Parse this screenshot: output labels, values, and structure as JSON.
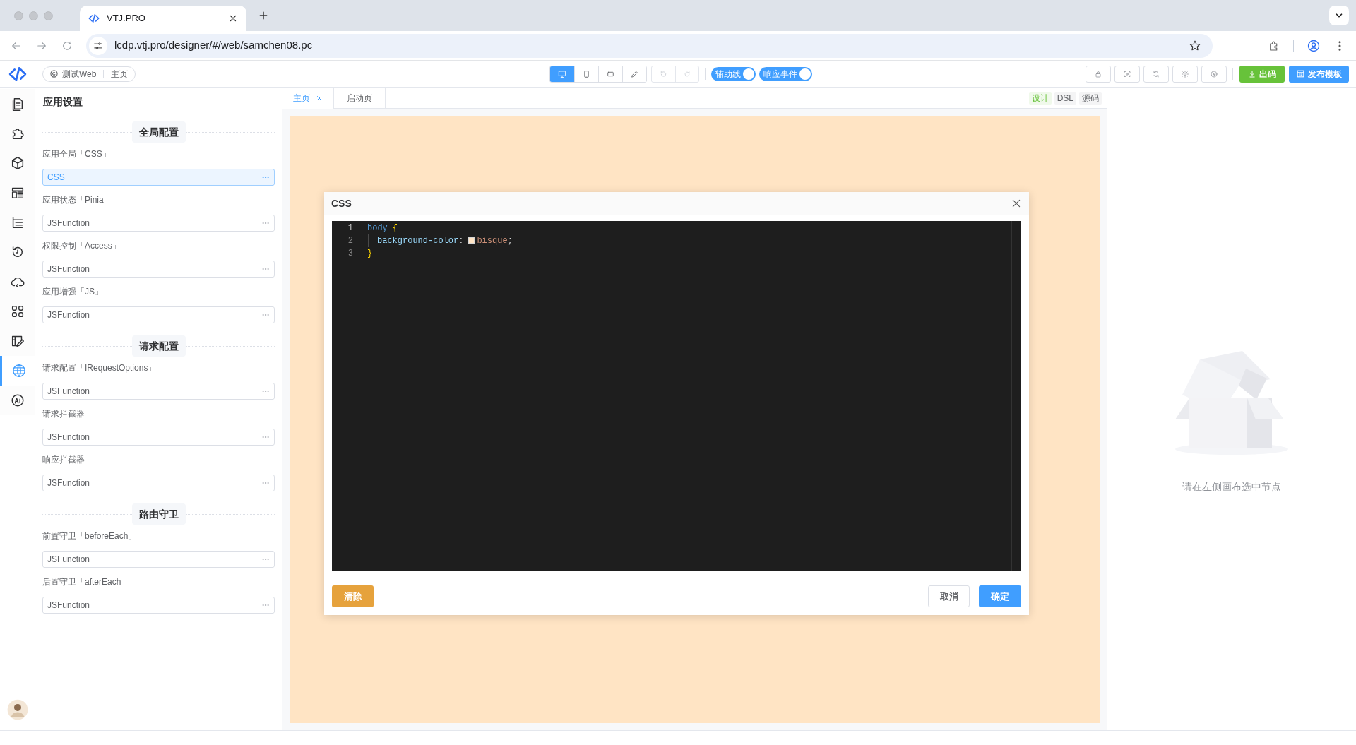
{
  "browser": {
    "tab_title": "VTJ.PRO",
    "url": "lcdp.vtj.pro/designer/#/web/samchen08.pc"
  },
  "app_toolbar": {
    "breadcrumb": [
      "测试Web",
      "主页"
    ],
    "devices": [
      {
        "selected": true
      },
      {
        "selected": false
      },
      {
        "selected": false
      },
      {
        "selected": false
      }
    ],
    "toggles": [
      {
        "label": "辅助线",
        "on": true
      },
      {
        "label": "响应事件",
        "on": true
      }
    ],
    "export_button": "出码",
    "publish_button": "发布模板"
  },
  "rail": [
    {
      "selected": false
    },
    {
      "selected": false
    },
    {
      "selected": false
    },
    {
      "selected": false
    },
    {
      "selected": false
    },
    {
      "selected": false
    },
    {
      "selected": false
    },
    {
      "selected": false
    },
    {
      "selected": false
    },
    {
      "selected": true
    },
    {
      "selected": false
    }
  ],
  "settings": {
    "title": "应用设置",
    "sections": [
      {
        "title": "全局配置",
        "fields": [
          {
            "label": "应用全局「CSS」",
            "value": "CSS",
            "selected": true
          },
          {
            "label": "应用状态「Pinia」",
            "value": "JSFunction",
            "selected": false
          },
          {
            "label": "权限控制「Access」",
            "value": "JSFunction",
            "selected": false
          },
          {
            "label": "应用增强「JS」",
            "value": "JSFunction",
            "selected": false
          }
        ]
      },
      {
        "title": "请求配置",
        "fields": [
          {
            "label": "请求配置「IRequestOptions」",
            "value": "JSFunction",
            "selected": false
          },
          {
            "label": "请求拦截器",
            "value": "JSFunction",
            "selected": false
          },
          {
            "label": "响应拦截器",
            "value": "JSFunction",
            "selected": false
          }
        ]
      },
      {
        "title": "路由守卫",
        "fields": [
          {
            "label": "前置守卫「beforeEach」",
            "value": "JSFunction",
            "selected": false
          },
          {
            "label": "后置守卫「afterEach」",
            "value": "JSFunction",
            "selected": false
          }
        ]
      }
    ]
  },
  "page_tabs": [
    {
      "label": "主页",
      "selected": true
    },
    {
      "label": "启动页",
      "selected": false
    }
  ],
  "view_modes": [
    {
      "label": "设计",
      "selected": true
    },
    {
      "label": "DSL",
      "selected": false
    },
    {
      "label": "源码",
      "selected": false
    }
  ],
  "dialog": {
    "title": "CSS",
    "code": [
      {
        "number": "1",
        "indent": false,
        "tokens": [
          {
            "text": "body",
            "kind": "selector"
          },
          {
            "text": "{",
            "kind": "brace"
          }
        ]
      },
      {
        "number": "2",
        "indent": true,
        "tokens": [
          {
            "text": "background-color",
            "kind": "property"
          },
          {
            "text": ":",
            "kind": "colon"
          },
          {
            "text": "bisque",
            "kind": "color"
          },
          {
            "text": ";",
            "kind": "plain"
          }
        ]
      },
      {
        "number": "3",
        "indent": false,
        "tokens": [
          {
            "text": "}",
            "kind": "brace"
          }
        ]
      }
    ],
    "clear_button": "清除",
    "cancel_button": "取消",
    "ok_button": "确定"
  },
  "right_panel": {
    "empty_text": "请在左侧画布选中节点"
  }
}
